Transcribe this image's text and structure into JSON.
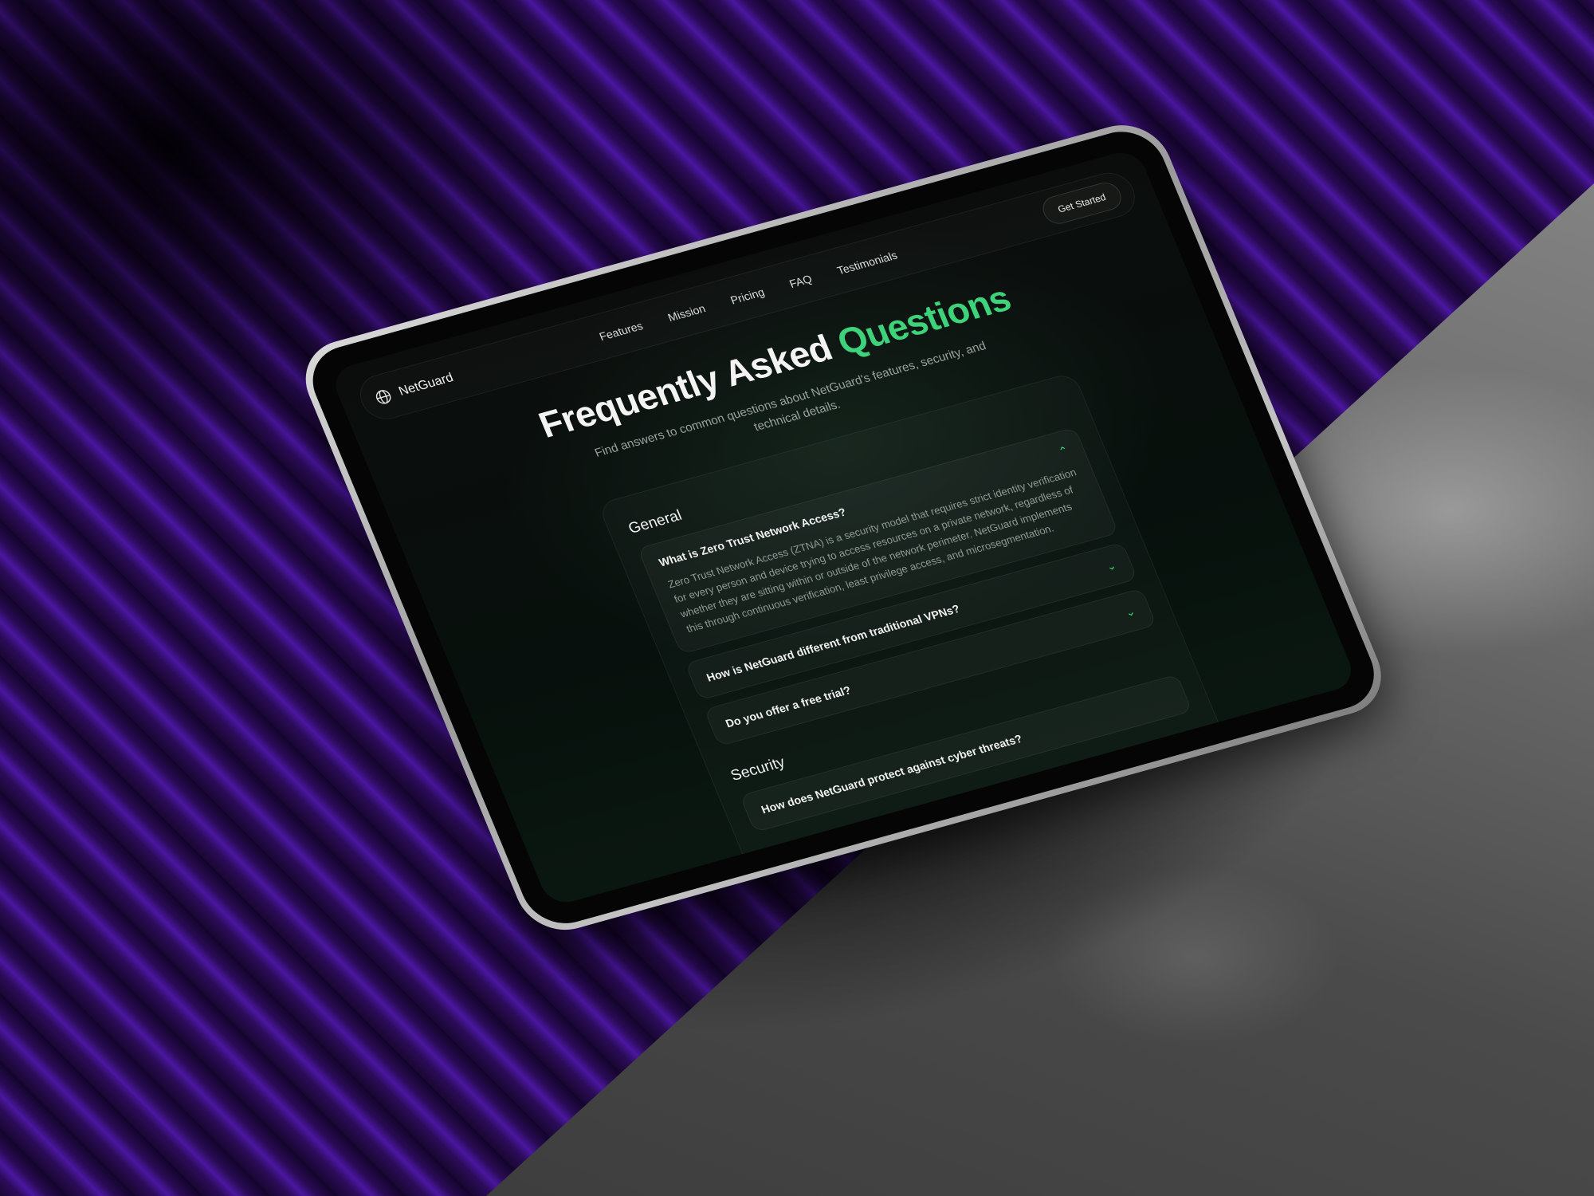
{
  "nav": {
    "brand": "NetGuard",
    "links": [
      "Features",
      "Mission",
      "Pricing",
      "FAQ",
      "Testimonials"
    ],
    "cta": "Get Started"
  },
  "hero": {
    "title_main": "Frequently Asked",
    "title_accent": "Questions",
    "subtitle": "Find answers to common questions about NetGuard's features, security, and technical details."
  },
  "faq": {
    "sections": [
      {
        "title": "General",
        "items": [
          {
            "question": "What is Zero Trust Network Access?",
            "answer": "Zero Trust Network Access (ZTNA) is a security model that requires strict identity verification for every person and device trying to access resources on a private network, regardless of whether they are sitting within or outside of the network perimeter. NetGuard implements this through continuous verification, least privilege access, and microsegmentation."
          },
          {
            "question": "How is NetGuard different from traditional VPNs?"
          },
          {
            "question": "Do you offer a free trial?"
          }
        ]
      },
      {
        "title": "Security",
        "items": [
          {
            "question": "How does NetGuard protect against cyber threats?"
          }
        ]
      }
    ]
  },
  "colors": {
    "accent": "#3ed27a",
    "background": "#0b0d0c",
    "backdrop": "#4a16a0"
  },
  "icons": {
    "brand": "globe-icon",
    "expanded": "chevron-up-icon",
    "collapsed": "chevron-down-icon"
  }
}
